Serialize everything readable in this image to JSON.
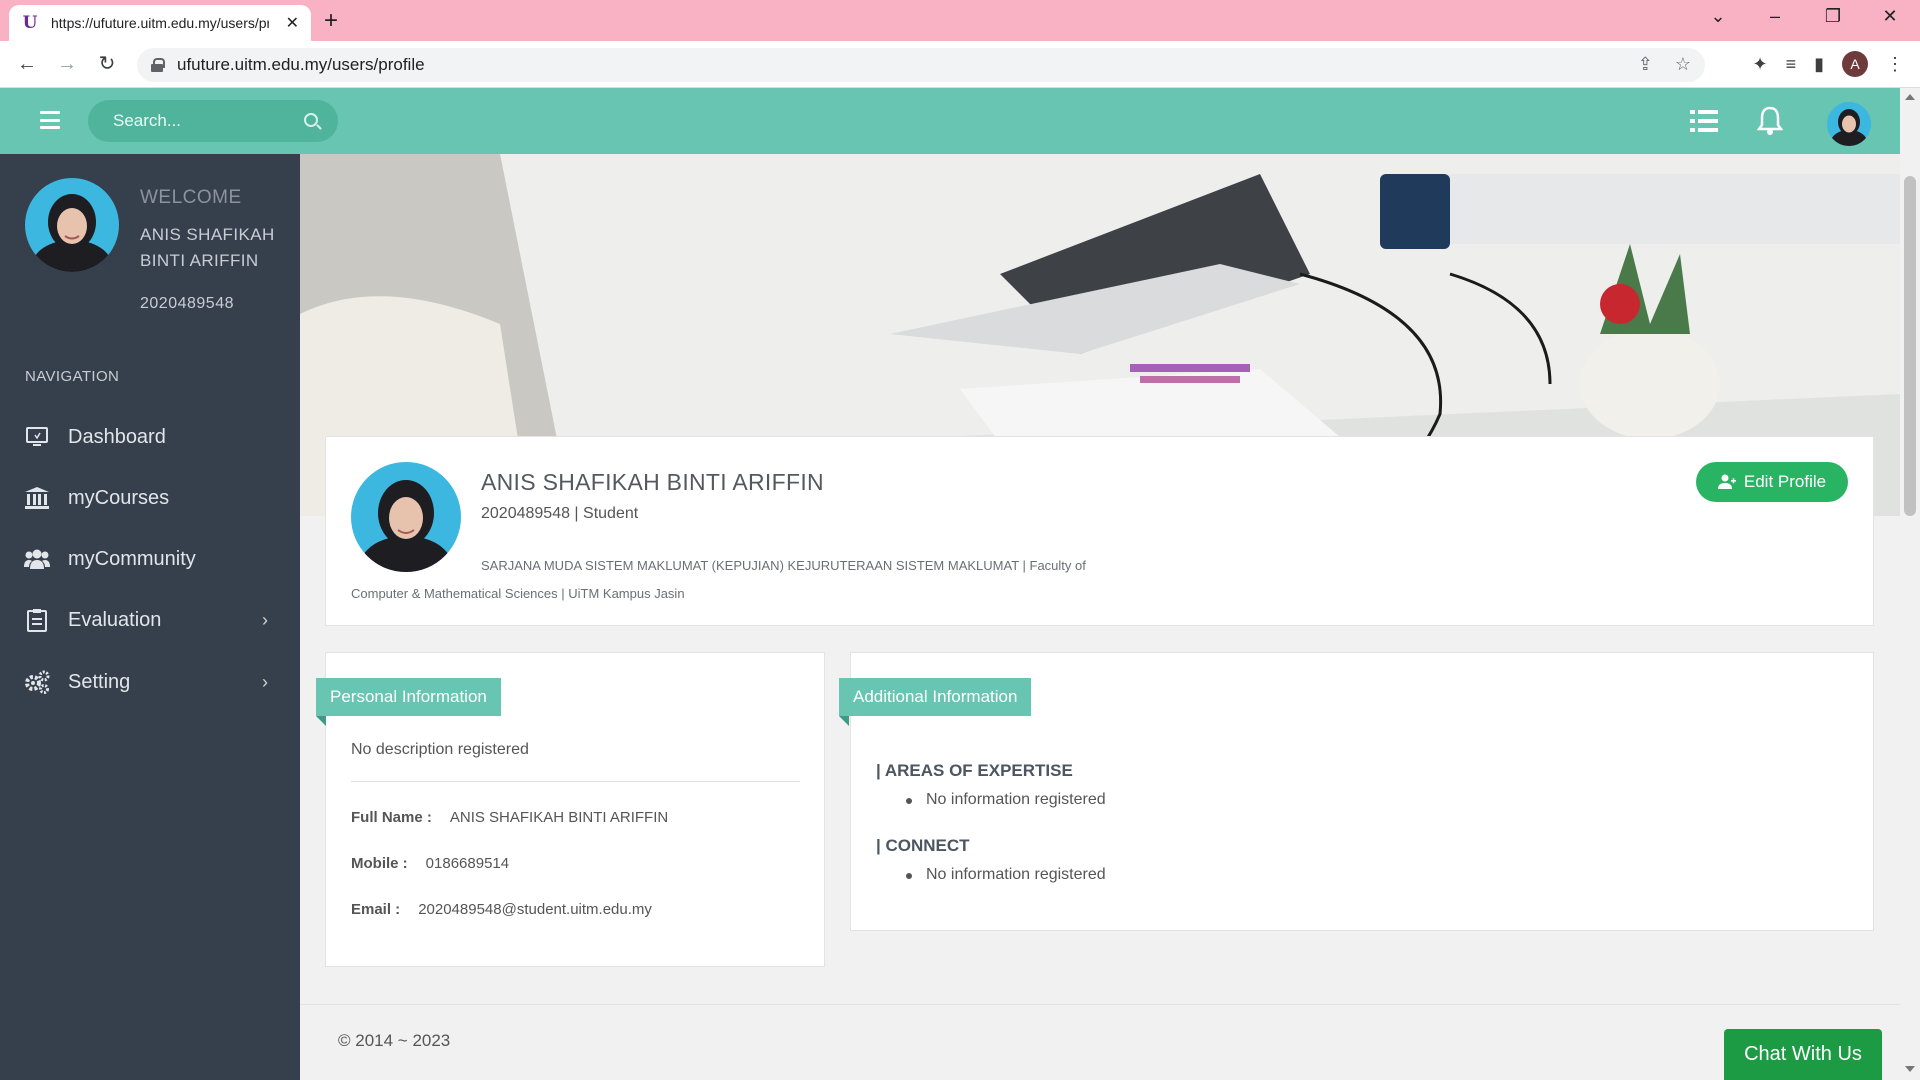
{
  "browser": {
    "tab_title": "https://ufuture.uitm.edu.my/users/profile",
    "favicon_letter": "U",
    "url": "ufuture.uitm.edu.my/users/profile",
    "profile_initial": "A"
  },
  "header": {
    "search_placeholder": "Search...",
    "icons": [
      "menu-icon",
      "search-icon",
      "list-icon",
      "bell-icon",
      "avatar"
    ]
  },
  "sidebar": {
    "welcome": "WELCOME",
    "name": "ANIS SHAFIKAH BINTI ARIFFIN",
    "id": "2020489548",
    "nav_heading": "NAVIGATION",
    "items": [
      {
        "label": "Dashboard",
        "icon": "monitor-icon"
      },
      {
        "label": "myCourses",
        "icon": "institution-icon"
      },
      {
        "label": "myCommunity",
        "icon": "users-icon"
      },
      {
        "label": "Evaluation",
        "icon": "clipboard-icon"
      },
      {
        "label": "Setting",
        "icon": "gears-icon"
      }
    ]
  },
  "profile": {
    "name": "ANIS SHAFIKAH BINTI ARIFFIN",
    "subtitle": "2020489548 | Student",
    "program": "SARJANA MUDA SISTEM MAKLUMAT (KEPUJIAN) KEJURUTERAAN SISTEM MAKLUMAT | Faculty of Computer & Mathematical Sciences | UiTM Kampus Jasin",
    "edit_label": "Edit Profile"
  },
  "personal": {
    "title": "Personal Information",
    "description": "No description registered",
    "full_name_label": "Full Name :",
    "full_name": "ANIS SHAFIKAH BINTI ARIFFIN",
    "mobile_label": "Mobile :",
    "mobile": "0186689514",
    "email_label": "Email :",
    "email": "2020489548@student.uitm.edu.my"
  },
  "additional": {
    "title": "Additional Information",
    "expertise_title": "| AREAS OF EXPERTISE",
    "expertise_item": "No information registered",
    "connect_title": "| CONNECT",
    "connect_item": "No information registered"
  },
  "footer": {
    "copyright": "© 2014 ~ 2023",
    "chat_label": "Chat With Us"
  },
  "colors": {
    "accent": "#67c5b1",
    "sidebar": "#363f4c",
    "edit_button": "#28b463",
    "chat_button": "#1d9a44",
    "tab_bar": "#f8b2c3"
  }
}
